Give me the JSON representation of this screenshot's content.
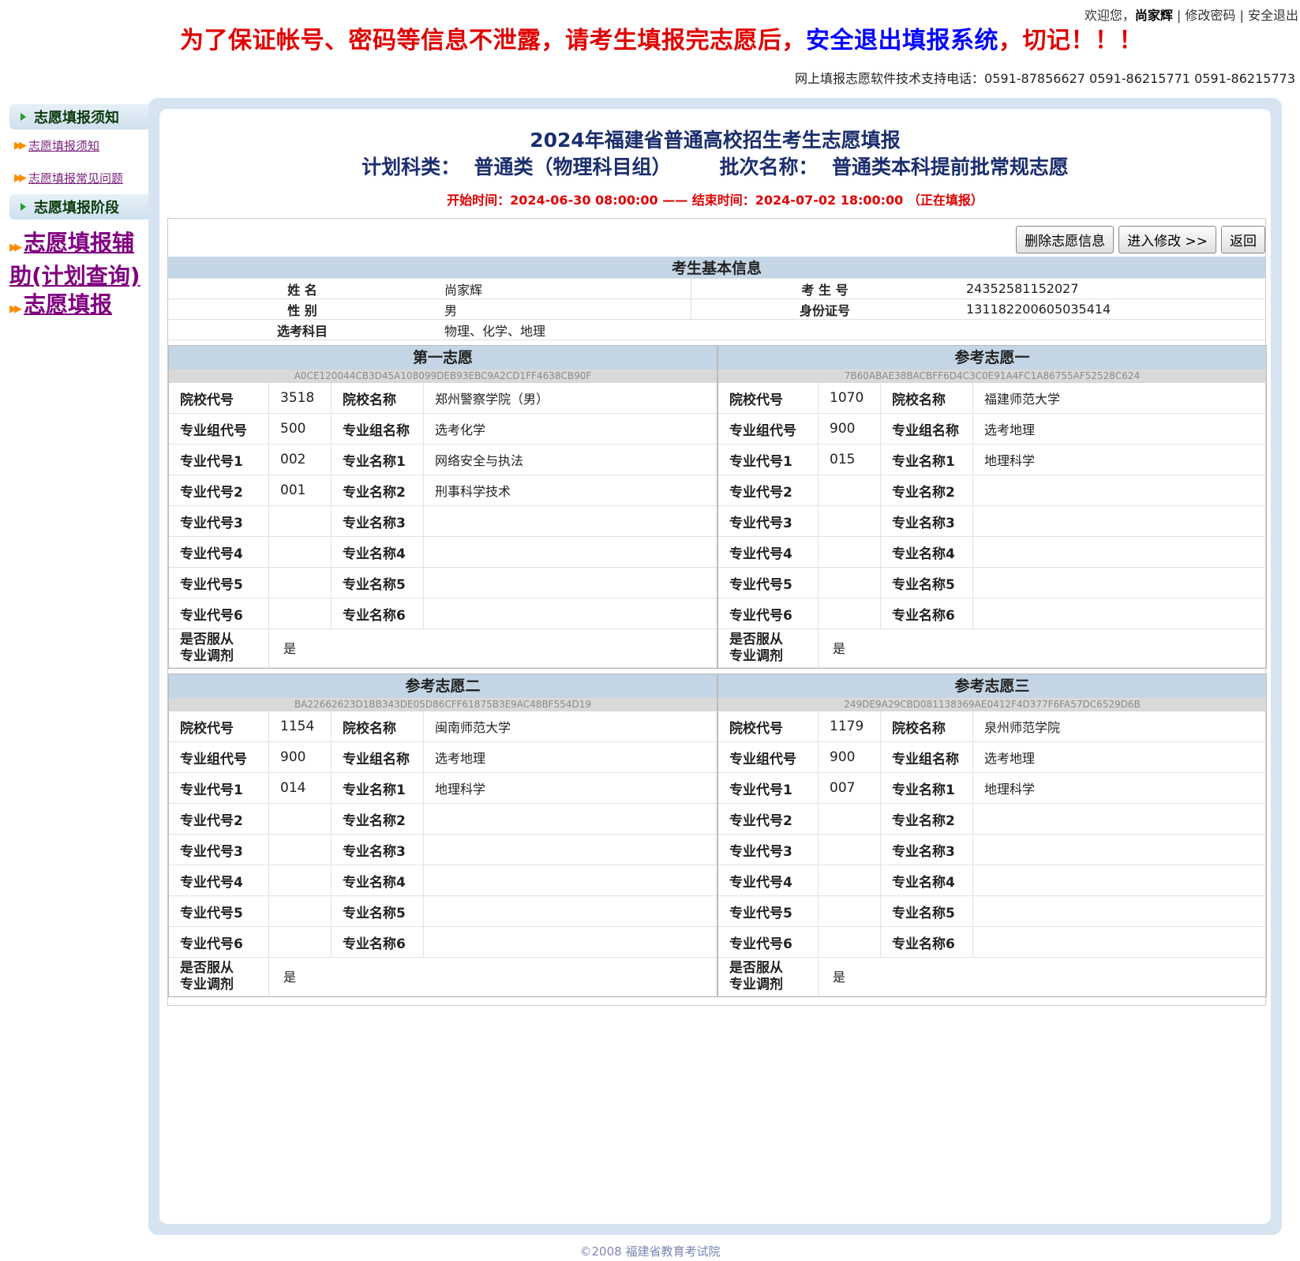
{
  "topbar": {
    "welcome": "欢迎您，",
    "username": "尚家辉",
    "sep1": " | ",
    "change_password": "修改密码",
    "sep2": " | ",
    "logout": "安全退出"
  },
  "warning": {
    "part1": "为了保证帐号、密码等信息不泄露，请考生填报完志愿后，",
    "part2": "安全退出填报系统",
    "part3": "，切记！！！"
  },
  "support": "网上填报志愿软件技术支持电话：0591-87856627 0591-86215771 0591-86215773",
  "sidebar": {
    "head1": "志愿填报须知",
    "link1": "志愿填报须知",
    "link2": "志愿填报常见问题",
    "head2": "志愿填报阶段",
    "big1": "志愿填报辅助(计划查询)",
    "big2": "志愿填报"
  },
  "title1": "2024年福建省普通高校招生考生志愿填报",
  "title2": "计划科类：  普通类（物理科目组）       批次名称：  普通类本科提前批常规志愿",
  "times": "开始时间：2024-06-30 08:00:00 —— 结束时间：2024-07-02 18:00:00 （正在填报）",
  "buttons": {
    "delete": "删除志愿信息",
    "modify": "进入修改 >>",
    "back": "返回"
  },
  "basic": {
    "title": "考生基本信息",
    "name_label": "姓  名",
    "name": "尚家辉",
    "exam_no_label": "考 生 号",
    "exam_no": "24352581152027",
    "gender_label": "性  别",
    "gender": "男",
    "id_label": "身份证号",
    "id_no": "131182200605035414",
    "subjects_label": "选考科目",
    "subjects": "物理、化学、地理"
  },
  "labels": {
    "school_code": "院校代号",
    "school_name": "院校名称",
    "group_code": "专业组代号",
    "group_name": "专业组名称",
    "major_code": [
      "专业代号1",
      "专业代号2",
      "专业代号3",
      "专业代号4",
      "专业代号5",
      "专业代号6"
    ],
    "major_name": [
      "专业名称1",
      "专业名称2",
      "专业名称3",
      "专业名称4",
      "专业名称5",
      "专业名称6"
    ],
    "adjust_1": "是否服从",
    "adjust_2": "专业调剂"
  },
  "volunteers": [
    {
      "title": "第一志愿",
      "hash": "A0CE120044CB3D45A108099DEB93EBC9A2CD1FF4638CB90F",
      "school_code": "3518",
      "school_name": "郑州警察学院（男）",
      "group_code": "500",
      "group_name": "选考化学",
      "majors": [
        {
          "code": "002",
          "name": "网络安全与执法"
        },
        {
          "code": "001",
          "name": "刑事科学技术"
        },
        {
          "code": "",
          "name": ""
        },
        {
          "code": "",
          "name": ""
        },
        {
          "code": "",
          "name": ""
        },
        {
          "code": "",
          "name": ""
        }
      ],
      "adjust": "是"
    },
    {
      "title": "参考志愿一",
      "hash": "7B60ABAE38BACBFF6D4C3C0E91A4FC1A86755AF52528C624",
      "school_code": "1070",
      "school_name": "福建师范大学",
      "group_code": "900",
      "group_name": "选考地理",
      "majors": [
        {
          "code": "015",
          "name": "地理科学"
        },
        {
          "code": "",
          "name": ""
        },
        {
          "code": "",
          "name": ""
        },
        {
          "code": "",
          "name": ""
        },
        {
          "code": "",
          "name": ""
        },
        {
          "code": "",
          "name": ""
        }
      ],
      "adjust": "是"
    },
    {
      "title": "参考志愿二",
      "hash": "BA22662623D1BB343DE05D86CFF61875B3E9AC48BF554D19",
      "school_code": "1154",
      "school_name": "闽南师范大学",
      "group_code": "900",
      "group_name": "选考地理",
      "majors": [
        {
          "code": "014",
          "name": "地理科学"
        },
        {
          "code": "",
          "name": ""
        },
        {
          "code": "",
          "name": ""
        },
        {
          "code": "",
          "name": ""
        },
        {
          "code": "",
          "name": ""
        },
        {
          "code": "",
          "name": ""
        }
      ],
      "adjust": "是"
    },
    {
      "title": "参考志愿三",
      "hash": "249DE9A29CBD081138369AE0412F4D377F6FA57DC6529D6B",
      "school_code": "1179",
      "school_name": "泉州师范学院",
      "group_code": "900",
      "group_name": "选考地理",
      "majors": [
        {
          "code": "007",
          "name": "地理科学"
        },
        {
          "code": "",
          "name": ""
        },
        {
          "code": "",
          "name": ""
        },
        {
          "code": "",
          "name": ""
        },
        {
          "code": "",
          "name": ""
        },
        {
          "code": "",
          "name": ""
        }
      ],
      "adjust": "是"
    }
  ],
  "footer": "©2008 福建省教育考试院"
}
